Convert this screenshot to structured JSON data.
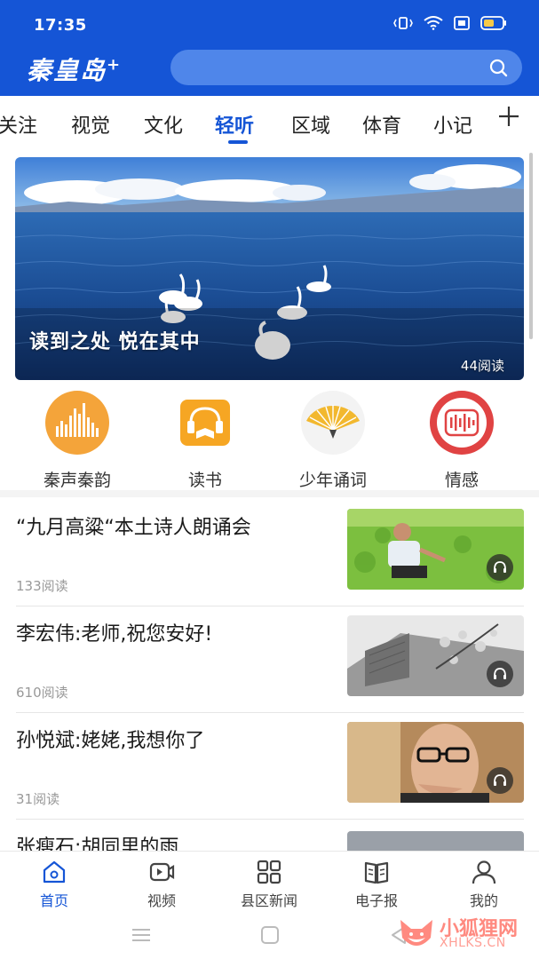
{
  "status_bar": {
    "time": "17:35"
  },
  "header": {
    "logo_text": "秦皇岛",
    "logo_suffix": "+",
    "search_placeholder": ""
  },
  "tabs": [
    "关注",
    "视觉",
    "文化",
    "轻听",
    "区域",
    "体育",
    "小记"
  ],
  "active_tab": "轻听",
  "banner": {
    "title": "读到之处  悦在其中",
    "reads": "44阅读"
  },
  "categories": [
    {
      "label": "秦声秦韵",
      "icon": "soundwave-icon"
    },
    {
      "label": "读书",
      "icon": "book-headphones-icon"
    },
    {
      "label": "少年诵词",
      "icon": "fan-icon"
    },
    {
      "label": "情感",
      "icon": "radio-icon"
    }
  ],
  "news": [
    {
      "title": "“九月高粱“本土诗人朗诵会",
      "reads": "133阅读"
    },
    {
      "title": "李宏伟:老师,祝您安好!",
      "reads": "610阅读"
    },
    {
      "title": "孙悦斌:姥姥,我想你了",
      "reads": "31阅读"
    },
    {
      "title": "张瘦石:胡同里的雨",
      "reads": ""
    }
  ],
  "bottom_nav": [
    {
      "label": "首页",
      "icon": "home-icon",
      "active": true
    },
    {
      "label": "视频",
      "icon": "video-icon"
    },
    {
      "label": "县区新闻",
      "icon": "grid-icon"
    },
    {
      "label": "电子报",
      "icon": "newspaper-icon"
    },
    {
      "label": "我的",
      "icon": "profile-icon"
    }
  ],
  "watermark": {
    "text": "小狐狸网",
    "url": "XHLKS.CN"
  },
  "colors": {
    "brand": "#1555d6",
    "search": "#4f86ea",
    "accent_orange": "#f4a43a",
    "accent_red": "#e04343"
  }
}
